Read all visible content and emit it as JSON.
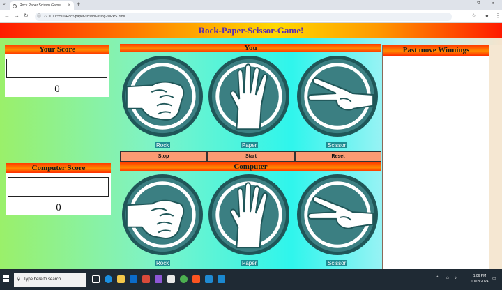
{
  "browser": {
    "tab_title": "Rock Paper Scissor Game",
    "url": "127.0.0.1:5500/Rock-paper-scissor-using-js/RPS.html"
  },
  "page": {
    "title": "Rock-Paper-Scissor-Game!",
    "your_score": {
      "label": "Your Score",
      "input_value": "",
      "score": "0"
    },
    "computer_score": {
      "label": "Computer Score",
      "input_value": "",
      "score": "0"
    },
    "you": {
      "label": "You",
      "choices": [
        {
          "label": "Rock",
          "icon": "fist-rock-icon"
        },
        {
          "label": "Paper",
          "icon": "open-hand-paper-icon"
        },
        {
          "label": "Scissor",
          "icon": "peace-hand-scissor-icon"
        }
      ]
    },
    "controls": {
      "stop": "Stop",
      "start": "Start",
      "reset": "Reset"
    },
    "computer": {
      "label": "Computer",
      "choices": [
        {
          "label": "Rock",
          "icon": "fist-rock-icon"
        },
        {
          "label": "Paper",
          "icon": "open-hand-paper-icon"
        },
        {
          "label": "Scissor",
          "icon": "peace-hand-scissor-icon"
        }
      ]
    },
    "past_moves": {
      "label": "Past move Winnings",
      "items": []
    }
  },
  "taskbar": {
    "search_placeholder": "Type here to search",
    "time": "1:06 PM",
    "date": "10/18/2024"
  },
  "colors": {
    "title_text": "#5a2fb0",
    "header_orange": "#ff5a00",
    "button_salmon": "#fb9b73",
    "caption_teal": "#1e8c92",
    "circle_teal": "#3b7f82"
  }
}
